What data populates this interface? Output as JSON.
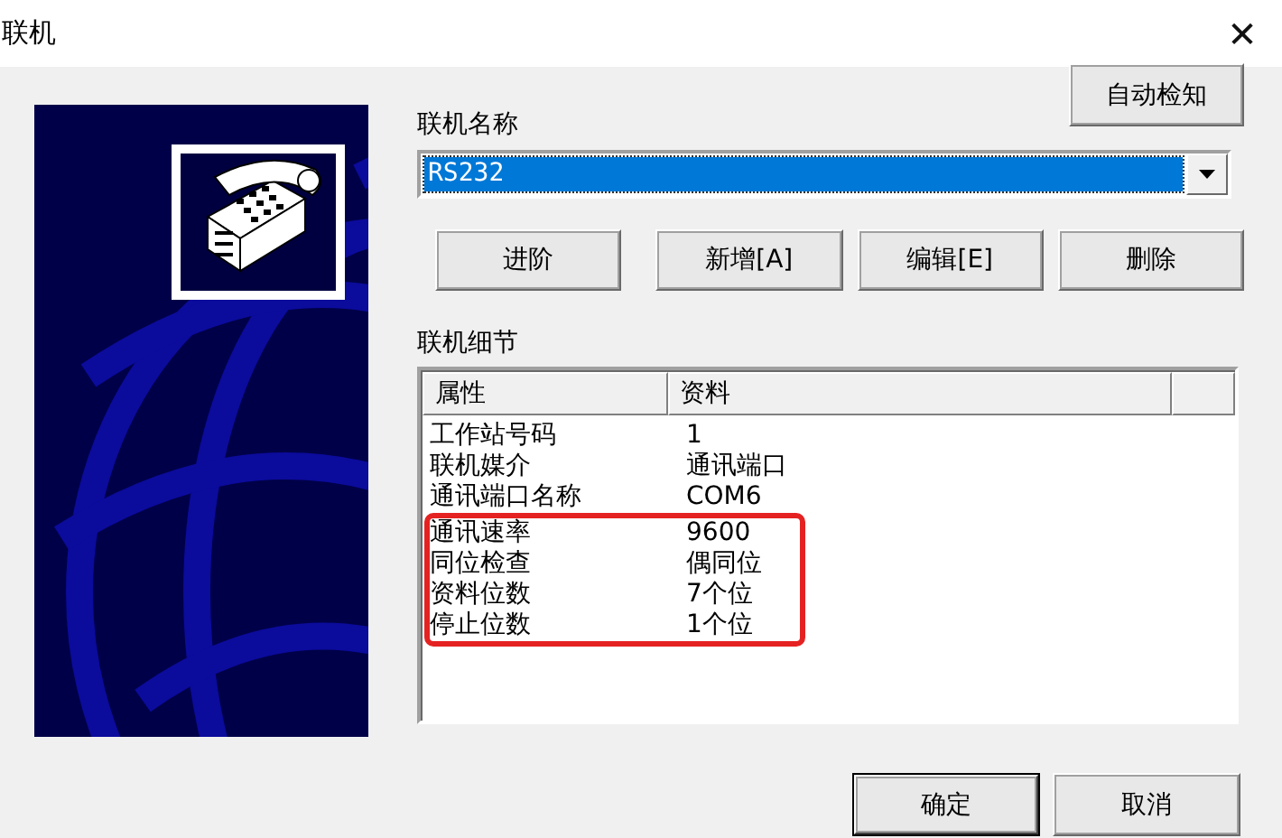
{
  "window": {
    "title": "联机",
    "close": "✕"
  },
  "auto_detect_button": "自动检知",
  "connection_name": {
    "label": "联机名称",
    "value": "RS232",
    "focused": true
  },
  "action_buttons": [
    {
      "label": "进阶"
    },
    {
      "label": "新增[A]"
    },
    {
      "label": "编辑[E]"
    },
    {
      "label": "删除"
    }
  ],
  "details": {
    "label": "联机细节",
    "columns": [
      "属性",
      "资料"
    ],
    "rows": [
      {
        "property": "工作站号码",
        "value": "1",
        "highlighted": false
      },
      {
        "property": "联机媒介",
        "value": "通讯端口",
        "highlighted": false
      },
      {
        "property": "通讯端口名称",
        "value": "COM6",
        "highlighted": false
      },
      {
        "property": "通讯速率",
        "value": "9600",
        "highlighted": true
      },
      {
        "property": "同位检查",
        "value": "偶同位",
        "highlighted": true
      },
      {
        "property": "资料位数",
        "value": "7个位",
        "highlighted": true
      },
      {
        "property": "停止位数",
        "value": "1个位",
        "highlighted": true
      }
    ]
  },
  "dialog_buttons": [
    {
      "label": "确定",
      "default": true
    },
    {
      "label": "取消",
      "default": false
    }
  ]
}
